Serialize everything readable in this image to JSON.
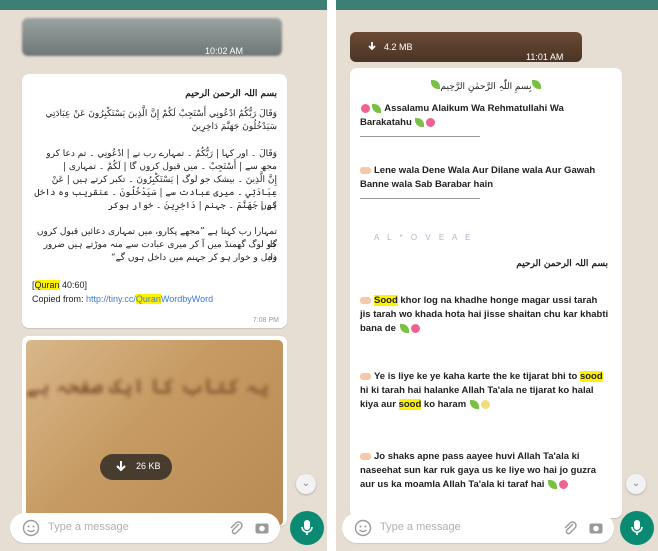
{
  "left": {
    "top_media_time": "10:02 AM",
    "msg1": {
      "line1": "بسم اللہ الرحمن الرحیم",
      "line2": "وَقَالَ رَبُّكُمُ ادْعُونِي أَسْتَجِبْ لَكُمْ إِنَّ الَّذِينَ يَسْتَكْبِرُونَ عَنْ عِبَادَتِي",
      "line3": "سَيَدْخُلُونَ جَهَنَّمَ دَاخِرِينَ",
      "line4": "وَقَالَ ۔ اور کہا | رَبُّكُمُ ۔ تمہارے رب نے | ادْعُونِي ۔ تم دعا کرو",
      "line5": "مجھ سے | أَسْتَجِبْ ۔ میں قبول کروں گا | لَكُمْ ۔ تمہاری |",
      "line6": "إِنَّ الَّذِينَ ۔ بیشک جو لوگ | يَسْتَكْبِرُونَ ۔ تکبر کرتے ہیں | عَنْ",
      "line7": "عِبَادَتِي ۔ میری عبادت سے | سَيَدْخُلُونَ ۔ عنقریب وہ داخل ہوں",
      "line8": "گے | جَهَنَّمَ ۔ جہنم | دَاخِرِينَ ۔ خوار ہوکر",
      "line9": "تمہارا رب کہتا ہے ”مجھے پکارو، میں تمہاری دعائیں قبول کروں گا،",
      "line10": "جو لوگ گھمنڈ میں آ کر میری عبادت سے منہ موڑتے ہیں ضرور وہ",
      "line11": "ذلیل و خوار ہو کر جہنم میں داخل ہوں گے“",
      "cite_open": "[",
      "cite_quran": "Quran",
      "cite_ref": " 40:60]",
      "copied_label": "Copied from: ",
      "link_pre": "http://tiny.cc/",
      "link_hl": "Quran",
      "link_post": "WordbyWord",
      "time": "7:08 PM"
    },
    "img_overlay_text": "یہ کتاب کا ایک صفحہ ہے",
    "download_size": "26 KB",
    "input_placeholder": "Type a message"
  },
  "right": {
    "top_size": "4.2 MB",
    "top_time": "11:01 AM",
    "msg": {
      "bismillah_header": "بِسمِ اللّٰہِ الرَّحمٰنِ الرَّحِیم",
      "salam": "Assalamu Alaikum Wa Rehmatullahi Wa Barakatahu",
      "lene_wala": "Lene wala Dene Wala Aur Dilane wala Aur Gawah Banne wala Sab Barabar hain",
      "spaced": "A L * O V E A E",
      "bismillah2": "بسم اللہ الرحمن الرحیم",
      "p1_hl": "Sood",
      "p1_rest": " khor log na khadhe honge magar ussi tarah jis tarah wo khada hota hai jisse shaitan chu kar khabti bana de",
      "p2_a": "Ye is liye ke ye kaha karte the ke tijarat bhi to ",
      "p2_hl1": "sood",
      "p2_b": " hi ki tarah hai halanke Allah Ta'ala ne tijarat ko halal kiya aur ",
      "p2_hl2": "sood",
      "p2_c": " ko haram",
      "p3": "Jo shaks apne pass aayee huvi Allah Ta'ala ki naseehat sun kar ruk gaya us ke liye wo hai jo guzra aur us ka moamla Allah Ta'ala ki taraf hai"
    },
    "input_placeholder": "Type a message"
  },
  "colors": {
    "accent": "#0b8a73",
    "chat_bg": "#e6ddd3",
    "highlight": "#fff200",
    "link": "#3a7bd5"
  }
}
